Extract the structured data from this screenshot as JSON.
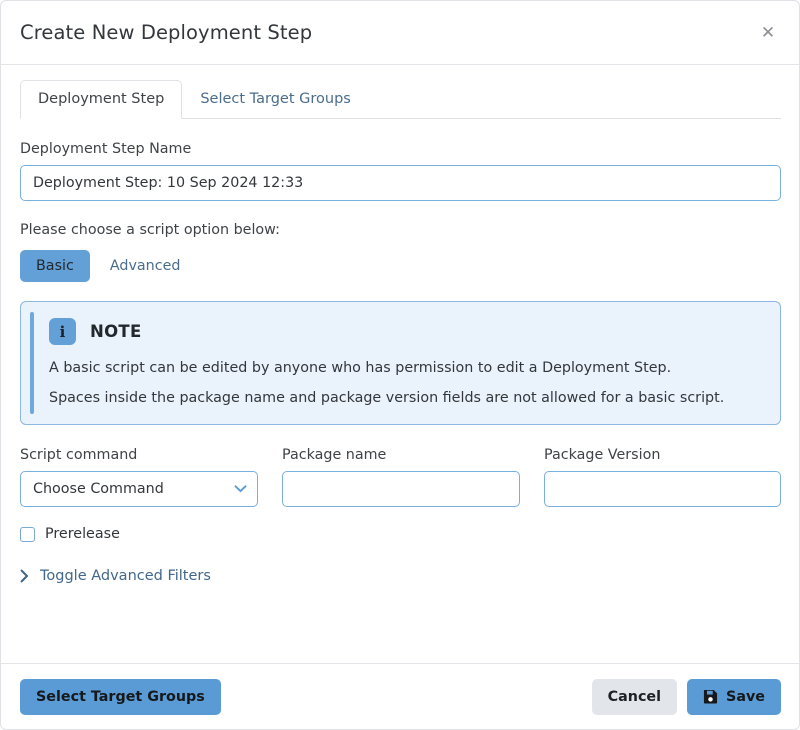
{
  "dialog": {
    "title": "Create New Deployment Step",
    "close_icon": "close-icon"
  },
  "tabs": [
    {
      "label": "Deployment Step",
      "active": true
    },
    {
      "label": "Select Target Groups",
      "active": false
    }
  ],
  "form": {
    "name_label": "Deployment Step Name",
    "name_value": "Deployment Step: 10 Sep 2024 12:33",
    "name_placeholder": "Deployment Step Name",
    "script_option_text": "Please choose a script option below:",
    "script_options": [
      {
        "label": "Basic",
        "selected": true
      },
      {
        "label": "Advanced",
        "selected": false
      }
    ],
    "script_command_label": "Script command",
    "script_command_value": "Choose Command",
    "package_name_label": "Package name",
    "package_name_value": "",
    "package_name_placeholder": "",
    "package_version_label": "Package Version",
    "package_version_value": "",
    "package_version_placeholder": "",
    "prerelease_label": "Prerelease",
    "prerelease_checked": false,
    "toggle_advanced_filters_label": "Toggle Advanced Filters"
  },
  "note": {
    "icon": "info-icon",
    "title": "NOTE",
    "line1": "A basic script can be edited by anyone who has permission to edit a Deployment Step.",
    "line2": "Spaces inside the package name and package version fields are not allowed for a basic script."
  },
  "footer": {
    "select_target_groups_label": "Select Target Groups",
    "cancel_label": "Cancel",
    "save_label": "Save",
    "save_icon": "save-icon"
  },
  "colors": {
    "accent_blue": "#5a9bd5",
    "border_blue": "#79b0e0",
    "note_bg": "#eaf2fb",
    "note_border": "#8cb8e2",
    "link_blue": "#4a6d8c",
    "secondary_bg": "#e2e6ea"
  }
}
